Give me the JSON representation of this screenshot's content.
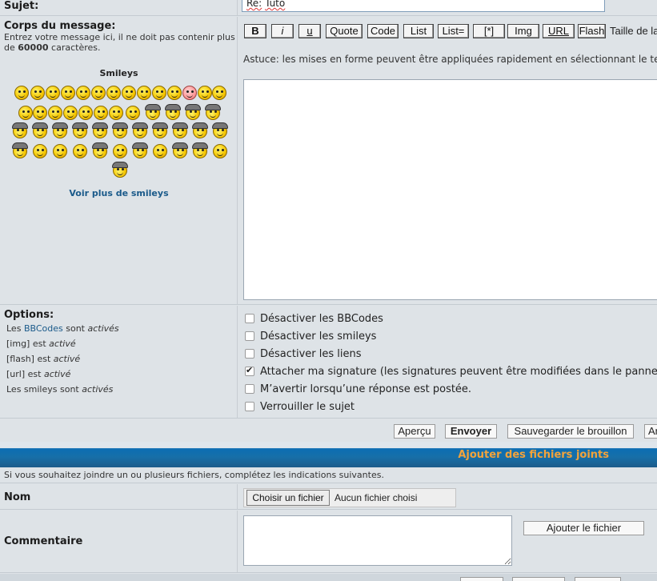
{
  "subject": {
    "label": "Sujet:",
    "value_prefix": "Re:",
    "value_word": "Tuto"
  },
  "message": {
    "label": "Corps du message:",
    "help_prefix": "Entrez votre message ici, il ne doit pas contenir plus de",
    "help_limit": "60000",
    "help_suffix": "caractères.",
    "smileys_title": "Smileys",
    "more_smileys": "Voir plus de smileys"
  },
  "toolbar": {
    "bold": "B",
    "italic": "i",
    "underline": "u",
    "quote": "Quote",
    "code": "Code",
    "list": "List",
    "list_eq": "List=",
    "item": "[*]",
    "img": "Img",
    "url": "URL",
    "flash": "Flash",
    "size_label": "Taille de la"
  },
  "tip": "Astuce: les mises en forme peuvent être appliquées rapidement en sélectionnant le te",
  "options": {
    "label": "Options:",
    "status": {
      "bbcodes_pre": "Les",
      "bbcodes_link": "BBCodes",
      "bbcodes_mid": "sont",
      "bbcodes_state": "activés",
      "img_pre": "[img] est",
      "img_state": "activé",
      "flash_pre": "[flash] est",
      "flash_state": "activé",
      "url_pre": "[url] est",
      "url_state": "activé",
      "smileys_pre": "Les smileys sont",
      "smileys_state": "activés"
    },
    "checkboxes": [
      {
        "label": "Désactiver les BBCodes",
        "checked": false
      },
      {
        "label": "Désactiver les smileys",
        "checked": false
      },
      {
        "label": "Désactiver les liens",
        "checked": false
      },
      {
        "label": "Attacher ma signature (les signatures peuvent être modifiées dans le panne",
        "checked": true
      },
      {
        "label": "M’avertir lorsqu’une réponse est postée.",
        "checked": false
      },
      {
        "label": "Verrouiller le sujet",
        "checked": false
      }
    ]
  },
  "actions": {
    "preview": "Aperçu",
    "submit": "Envoyer",
    "save_draft": "Sauvegarder le brouillon",
    "cancel_partial": "An"
  },
  "attachments": {
    "title": "Ajouter des fichiers joints",
    "help": "Si vous souhaitez joindre un ou plusieurs fichiers, complétez les indications suivantes.",
    "name_label": "Nom",
    "choose_file": "Choisir un fichier",
    "no_file": "Aucun fichier choisi",
    "comment_label": "Commentaire",
    "add_file": "Ajouter le fichier"
  },
  "colors": {
    "accent_blue": "#0c6eb3",
    "title_orange": "#f3a33b",
    "link": "#1a5a8a",
    "bg": "#dee3e7"
  }
}
